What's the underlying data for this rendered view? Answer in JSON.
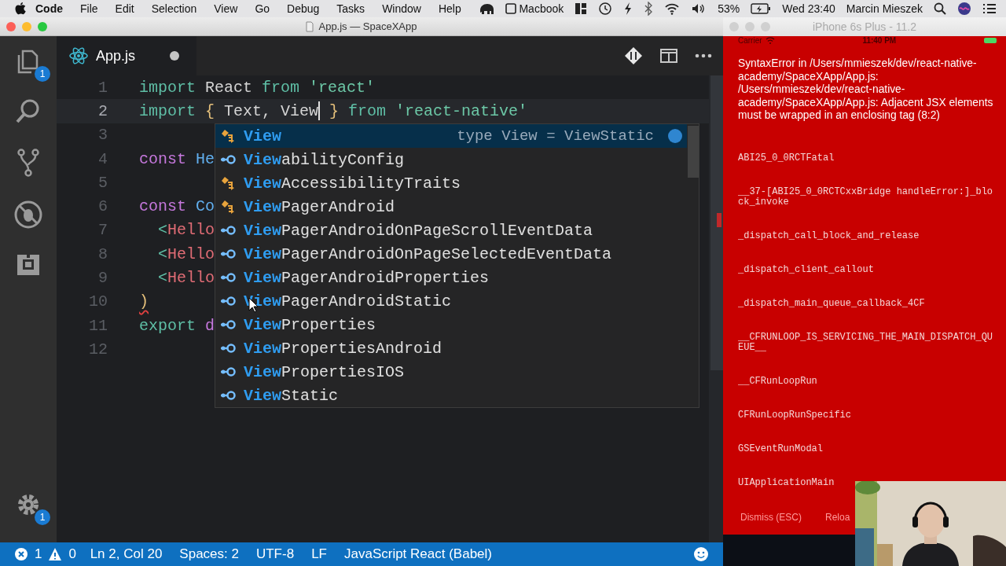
{
  "menu_bar": {
    "app": "Code",
    "menus": [
      "File",
      "Edit",
      "Selection",
      "View",
      "Go",
      "Debug",
      "Tasks",
      "Window",
      "Help"
    ],
    "device": "Macbook",
    "battery": "53%",
    "clock": "Wed 23:40",
    "user": "Marcin Mieszek"
  },
  "window": {
    "title": "App.js — SpaceXApp"
  },
  "activity_bar": {
    "explorer_badge": "1",
    "settings_badge": "1"
  },
  "tabs": [
    {
      "label": "App.js",
      "selected": true,
      "dirty": true
    }
  ],
  "editor": {
    "lines": [
      {
        "number": "1",
        "current": false,
        "tokens": [
          {
            "kind": "keyword",
            "text": "import"
          },
          {
            "kind": "ident",
            "text": " React "
          },
          {
            "kind": "keyword",
            "text": "from"
          },
          {
            "kind": "string",
            "text": " 'react'"
          }
        ]
      },
      {
        "number": "2",
        "current": true,
        "tokens": [
          {
            "kind": "keyword",
            "text": "import"
          },
          {
            "kind": "brace",
            "text": " {"
          },
          {
            "kind": "ident",
            "text": " Text, View"
          },
          {
            "kind": "caret"
          },
          {
            "kind": "brace",
            "text": " }"
          },
          {
            "kind": "keyword",
            "text": " from"
          },
          {
            "kind": "string",
            "text": " 'react-native'"
          }
        ]
      },
      {
        "number": "3",
        "current": false
      },
      {
        "number": "4",
        "current": false,
        "tokens": [
          {
            "kind": "storage",
            "text": "const"
          },
          {
            "kind": "func",
            "text": " He"
          }
        ]
      },
      {
        "number": "5",
        "current": false
      },
      {
        "number": "6",
        "current": false,
        "tokens": [
          {
            "kind": "storage",
            "text": "const"
          },
          {
            "kind": "func",
            "text": " Co"
          }
        ]
      },
      {
        "number": "7",
        "current": false,
        "tokens": [
          {
            "kind": "tagpunct",
            "text": "  <"
          },
          {
            "kind": "tag",
            "text": "Hello"
          }
        ]
      },
      {
        "number": "8",
        "current": false,
        "tokens": [
          {
            "kind": "tagpunct",
            "text": "  <"
          },
          {
            "kind": "tag",
            "text": "Hello"
          }
        ]
      },
      {
        "number": "9",
        "current": false,
        "tokens": [
          {
            "kind": "tagpunct",
            "text": "  <"
          },
          {
            "kind": "tag",
            "text": "Hello"
          }
        ]
      },
      {
        "number": "10",
        "current": false,
        "tokens": [
          {
            "kind": "error",
            "text": ")"
          }
        ]
      },
      {
        "number": "11",
        "current": false,
        "tokens": [
          {
            "kind": "keyword",
            "text": "export"
          },
          {
            "kind": "storage",
            "text": " d"
          }
        ]
      },
      {
        "number": "12",
        "current": false
      }
    ]
  },
  "suggestions": [
    {
      "kind": "class",
      "match": "View",
      "selected": true,
      "detail": "type View = ViewStatic"
    },
    {
      "kind": "property",
      "match": "View",
      "rest": "abilityConfig",
      "selected": false
    },
    {
      "kind": "class",
      "match": "View",
      "rest": "AccessibilityTraits",
      "selected": false
    },
    {
      "kind": "class",
      "match": "View",
      "rest": "PagerAndroid",
      "selected": false
    },
    {
      "kind": "property",
      "match": "View",
      "rest": "PagerAndroidOnPageScrollEventData",
      "selected": false
    },
    {
      "kind": "property",
      "match": "View",
      "rest": "PagerAndroidOnPageSelectedEventData",
      "selected": false
    },
    {
      "kind": "property",
      "match": "View",
      "rest": "PagerAndroidProperties",
      "selected": false
    },
    {
      "kind": "property",
      "match": "View",
      "rest": "PagerAndroidStatic",
      "selected": false
    },
    {
      "kind": "property",
      "match": "View",
      "rest": "Properties",
      "selected": false
    },
    {
      "kind": "property",
      "match": "View",
      "rest": "PropertiesAndroid",
      "selected": false
    },
    {
      "kind": "property",
      "match": "View",
      "rest": "PropertiesIOS",
      "selected": false
    },
    {
      "kind": "property",
      "match": "View",
      "rest": "Static",
      "selected": false
    }
  ],
  "status_bar": {
    "errors": "1",
    "warnings": "0",
    "items": [
      "Ln 2, Col 20",
      "Spaces: 2",
      "UTF-8",
      "LF",
      "JavaScript React (Babel)"
    ]
  },
  "simulator": {
    "title": "iPhone 6s Plus - 11.2",
    "carrier": "Carrier",
    "time": "11:40 PM",
    "error_message": "SyntaxError in /Users/mmieszek/dev/react-native-academy/SpaceXApp/App.js: /Users/mmieszek/dev/react-native-academy/SpaceXApp/App.js: Adjacent JSX elements must be wrapped in an enclosing tag (8:2)",
    "stack": [
      "ABI25_0_0RCTFatal",
      "__37-[ABI25_0_0RCTCxxBridge handleError:]_block_invoke",
      "_dispatch_call_block_and_release",
      "_dispatch_client_callout",
      "_dispatch_main_queue_callback_4CF",
      "__CFRUNLOOP_IS_SERVICING_THE_MAIN_DISPATCH_QUEUE__",
      "__CFRunLoopRun",
      "CFRunLoopRunSpecific",
      "GSEventRunModal",
      "UIApplicationMain"
    ],
    "actions": [
      "Dismiss (ESC)",
      "Reloa"
    ]
  }
}
